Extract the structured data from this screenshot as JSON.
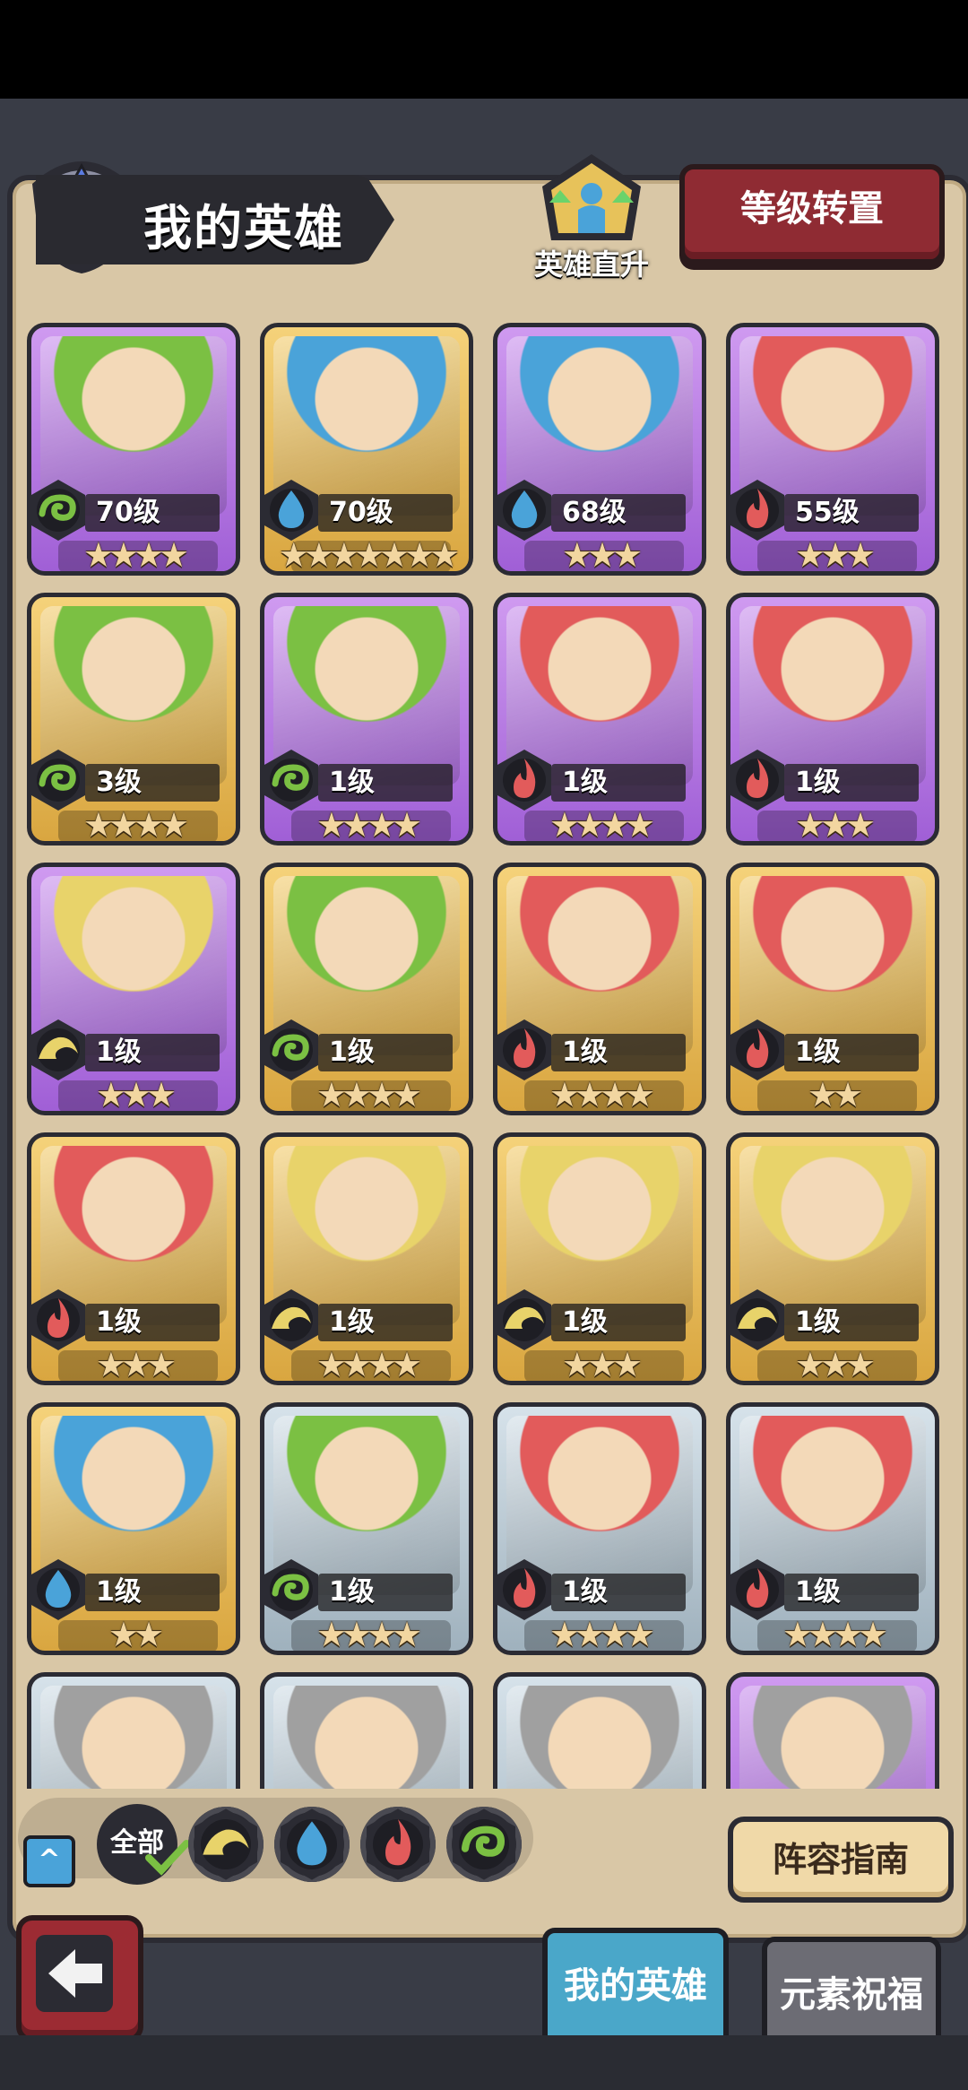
{
  "header": {
    "title": "我的英雄",
    "direct_up_label": "英雄直升",
    "transfer_button": "等级转置"
  },
  "heroes": [
    {
      "level": "70级",
      "element": "wind",
      "stars": "★★★★",
      "rarity": "purple"
    },
    {
      "level": "70级",
      "element": "water",
      "stars": "★★★★★★★",
      "rarity": "gold"
    },
    {
      "level": "68级",
      "element": "water",
      "stars": "★★★",
      "rarity": "purple"
    },
    {
      "level": "55级",
      "element": "fire",
      "stars": "★★★",
      "rarity": "purple"
    },
    {
      "level": "3级",
      "element": "wind",
      "stars": "★★★★",
      "rarity": "gold"
    },
    {
      "level": "1级",
      "element": "wind",
      "stars": "★★★★",
      "rarity": "purple"
    },
    {
      "level": "1级",
      "element": "fire",
      "stars": "★★★★",
      "rarity": "purple"
    },
    {
      "level": "1级",
      "element": "fire",
      "stars": "★★★",
      "rarity": "purple"
    },
    {
      "level": "1级",
      "element": "earth",
      "stars": "★★★",
      "rarity": "purple"
    },
    {
      "level": "1级",
      "element": "wind",
      "stars": "★★★★",
      "rarity": "gold"
    },
    {
      "level": "1级",
      "element": "fire",
      "stars": "★★★★",
      "rarity": "gold"
    },
    {
      "level": "1级",
      "element": "fire",
      "stars": "★★",
      "rarity": "gold"
    },
    {
      "level": "1级",
      "element": "fire",
      "stars": "★★★",
      "rarity": "gold"
    },
    {
      "level": "1级",
      "element": "earth",
      "stars": "★★★★",
      "rarity": "gold"
    },
    {
      "level": "1级",
      "element": "earth",
      "stars": "★★★",
      "rarity": "gold"
    },
    {
      "level": "1级",
      "element": "earth",
      "stars": "★★★",
      "rarity": "gold"
    },
    {
      "level": "1级",
      "element": "water",
      "stars": "★★",
      "rarity": "gold"
    },
    {
      "level": "1级",
      "element": "wind",
      "stars": "★★★★",
      "rarity": "silver"
    },
    {
      "level": "1级",
      "element": "fire",
      "stars": "★★★★",
      "rarity": "silver"
    },
    {
      "level": "1级",
      "element": "fire",
      "stars": "★★★★",
      "rarity": "silver"
    },
    {
      "level": "",
      "element": "",
      "stars": "",
      "rarity": "silver"
    },
    {
      "level": "",
      "element": "",
      "stars": "",
      "rarity": "silver"
    },
    {
      "level": "",
      "element": "",
      "stars": "",
      "rarity": "silver"
    },
    {
      "level": "",
      "element": "",
      "stars": "",
      "rarity": "purple"
    }
  ],
  "element_colors": {
    "wind": "#7bc043",
    "water": "#4aa3d9",
    "fire": "#e25b5b",
    "earth": "#e8d36a"
  },
  "filter": {
    "all_label": "全部",
    "elements": [
      "earth",
      "water",
      "fire",
      "wind"
    ]
  },
  "guide_button": "阵容指南",
  "tabs": {
    "my_heroes": "我的英雄",
    "element_blessing": "元素祝福"
  }
}
